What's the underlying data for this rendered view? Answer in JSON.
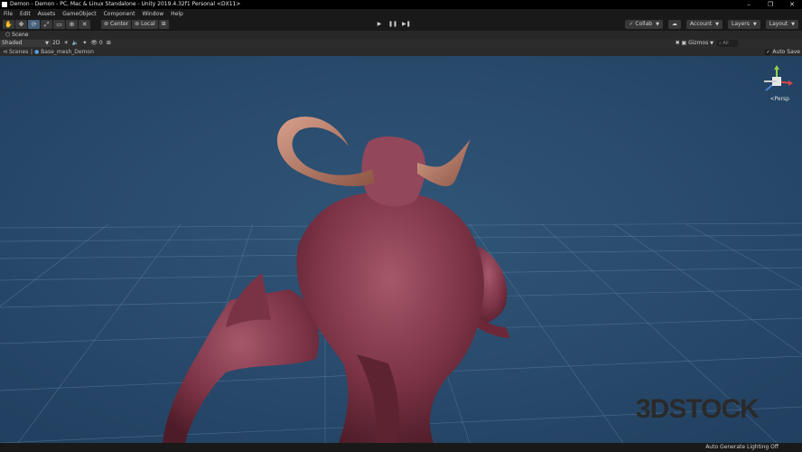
{
  "window": {
    "title": "Demon - Demon - PC, Mac & Linux Standalone - Unity 2019.4.32f1 Personal <DX11>",
    "controls": [
      "–",
      "❐",
      "✕"
    ]
  },
  "menu": [
    "File",
    "Edit",
    "Assets",
    "GameObject",
    "Component",
    "Window",
    "Help"
  ],
  "toolbar": {
    "tools": [
      "hand-icon",
      "move-icon",
      "rotate-icon",
      "scale-icon",
      "rect-icon",
      "transform-icon",
      "custom-tool-icon"
    ],
    "active_tool_index": 2,
    "pivot_mode": "Center",
    "pivot_rotation": "Local",
    "play": "▶",
    "pause": "❚❚",
    "step": "▶❚",
    "collab": "Collab",
    "account": "Account",
    "layers": "Layers",
    "layout": "Layout"
  },
  "scene": {
    "tab_label": "Scene",
    "shading_mode": "Shaded",
    "mode_2d": "2D",
    "gizmos_label": "Gizmos",
    "search_placeholder": "All",
    "persp_label": "<Persp",
    "breadcrumb": {
      "root": "Scenes",
      "item": "Base_mesh_Demon"
    },
    "auto_save_label": "Auto Save",
    "auto_save_checked": true
  },
  "watermark": "3DSTOCK",
  "status": {
    "text": "Auto Generate Lighting Off"
  },
  "colors": {
    "viewport_bg": "#2b4d72",
    "grid": "#6c8db0",
    "demon_skin": "#8a3c4c",
    "horn": "#b98070"
  }
}
